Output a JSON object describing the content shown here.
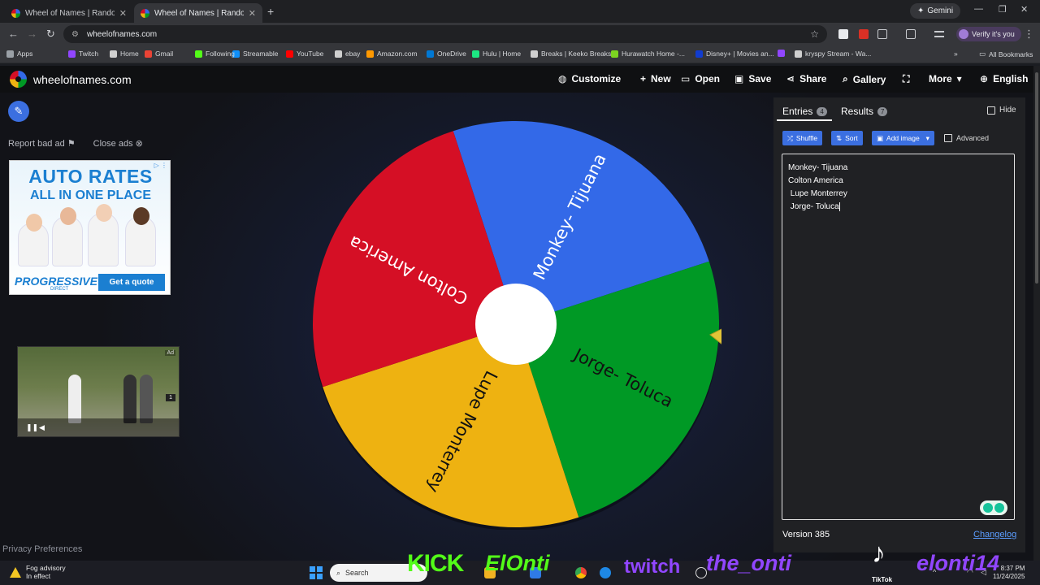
{
  "browser": {
    "tabs": [
      {
        "title": "Wheel of Names | Random name picker",
        "active": false
      },
      {
        "title": "Wheel of Names | Random name picker",
        "active": true
      }
    ],
    "gemini_label": "Gemini",
    "url": "wheelofnames.com",
    "profile_label": "Verify it's you",
    "bookmarks": [
      {
        "label": "Apps",
        "color": "#9aa0a6"
      },
      {
        "label": "Twitch",
        "color": "#9146ff"
      },
      {
        "label": "Home",
        "color": "#cfcfcf"
      },
      {
        "label": "Gmail",
        "color": "#ea4335"
      },
      {
        "label": "Following",
        "color": "#53fc18"
      },
      {
        "label": "Streamable",
        "color": "#0f90fa"
      },
      {
        "label": "YouTube",
        "color": "#ff0000"
      },
      {
        "label": "ebay",
        "color": "#cfcfcf"
      },
      {
        "label": "Amazon.com",
        "color": "#ff9900"
      },
      {
        "label": "OneDrive",
        "color": "#0078d4"
      },
      {
        "label": "Hulu | Home",
        "color": "#1ce783"
      },
      {
        "label": "Breaks | Keeko Breaks",
        "color": "#cfcfcf"
      },
      {
        "label": "Hurawatch Home -...",
        "color": "#7cd320"
      },
      {
        "label": "Disney+ | Movies an...",
        "color": "#113ccf"
      },
      {
        "label": "",
        "color": "#9146ff"
      },
      {
        "label": "kryspy Stream - Wa...",
        "color": "#cfcfcf"
      }
    ],
    "all_bookmarks": "All Bookmarks"
  },
  "app": {
    "brand": "wheelofnames.com",
    "nav": [
      {
        "label": "Customize",
        "icon": "palette-icon"
      },
      {
        "label": "New",
        "icon": "file-icon"
      },
      {
        "label": "Open",
        "icon": "folder-icon"
      },
      {
        "label": "Save",
        "icon": "save-icon"
      },
      {
        "label": "Share",
        "icon": "share-icon"
      },
      {
        "label": "Gallery",
        "icon": "search-icon"
      },
      {
        "label": "",
        "icon": "fullscreen-icon"
      },
      {
        "label": "More",
        "icon": "chevron-down-icon"
      },
      {
        "label": "English",
        "icon": "globe-icon"
      }
    ]
  },
  "left": {
    "report_bad_ad": "Report bad ad",
    "close_ads": "Close ads",
    "ad": {
      "headline1": "AUTO RATES",
      "headline2": "ALL IN ONE PLACE",
      "brand": "PROGRESSIVE",
      "brand_sub": "DIRECT",
      "cta": "Get a quote"
    },
    "video_ad": {
      "ad_label": "Ad",
      "counter": "1"
    },
    "privacy": "Privacy Preferences"
  },
  "wheel": {
    "segments": [
      {
        "label": "Monkey- Tijuana",
        "color": "#3369e8"
      },
      {
        "label": "Jorge- Toluca",
        "color": "#009925"
      },
      {
        "label": "Lupe Monterrey",
        "color": "#eeb211"
      },
      {
        "label": "Colton America",
        "color": "#d50f25"
      }
    ]
  },
  "panel": {
    "tab_entries": "Entries",
    "entries_count": "4",
    "tab_results": "Results",
    "results_count": "7",
    "hide_label": "Hide",
    "shuffle": "Shuffle",
    "sort": "Sort",
    "add_image": "Add image",
    "advanced": "Advanced",
    "entries": [
      "Monkey- Tijuana",
      "Colton America",
      " Lupe Monterrey",
      " Jorge- Toluca"
    ],
    "version": "Version 385",
    "changelog": "Changelog"
  },
  "taskbar": {
    "weather_title": "Fog advisory",
    "weather_sub": "In effect",
    "search": "Search",
    "time": "8:37 PM",
    "date": "11/24/2025"
  },
  "overlay": {
    "kick": "KICK",
    "kick_name": "ElOnti",
    "twitch": "twitch",
    "twitch_name": "the_onti",
    "tiktok": "TikTok",
    "tiktok_name": "elonti14"
  }
}
